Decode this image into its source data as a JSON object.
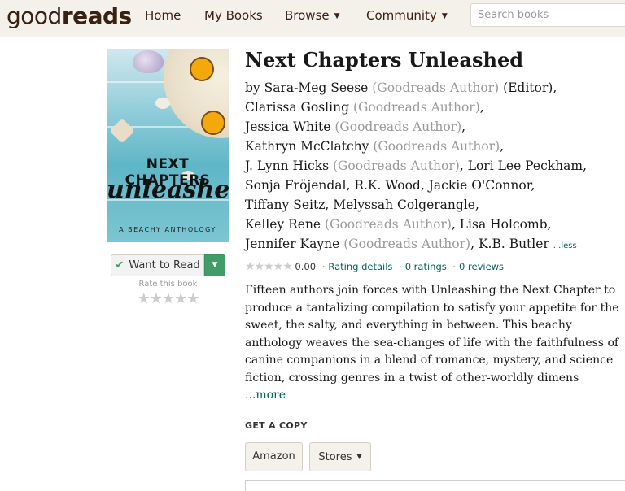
{
  "header": {
    "logo_light": "good",
    "logo_bold": "reads",
    "nav": [
      {
        "label": "Home"
      },
      {
        "label": "My Books"
      },
      {
        "label": "Browse"
      },
      {
        "label": "Community"
      }
    ],
    "search_placeholder": "Search books"
  },
  "book": {
    "title": "Next Chapters Unleashed",
    "cover": {
      "title_line1": "NEXT CHAPTERS",
      "title_line2": "unleashed",
      "subtitle": "A BEACHY ANTHOLOGY"
    },
    "authors": {
      "by": "by",
      "sara": "Sara-Meg Seese",
      "gr_author": "(Goodreads Author)",
      "editor": "(Editor),",
      "clarissa": "Clarissa Gosling",
      "jessica": "Jessica White",
      "kathryn": "Kathryn McClatchy",
      "lynn": "J. Lynn Hicks",
      "lori": "Lori Lee Peckham,",
      "sonja": "Sonja Fröjendal, R.K. Wood, Jackie O'Connor,",
      "tiffany": "Tiffany Seitz, Melyssah Colgerangle,",
      "kelley": "Kelley Rene",
      "lisa": "Lisa Holcomb,",
      "jennifer": "Jennifer Kayne",
      "kb": "K.B. Butler",
      "less": "...less",
      "comma": ","
    },
    "rating": {
      "stars": "★★★★★",
      "value": "0.00",
      "rating_details": "Rating details",
      "ratings": "0 ratings",
      "reviews": "0 reviews"
    },
    "description": "Fifteen authors join forces with Unleashing the Next Chapter to produce a tantalizing compilation to satisfy your appetite for the sweet, the salty, and everything in between. This beachy anthology weaves the sea-changes of life with the faithfulness of canine companions in a blend of romance, mystery, and science fiction, crossing genres in a twist of other-worldly dimens",
    "more": "...more"
  },
  "shelf": {
    "want_to_read": "Want to Read",
    "rate_label": "Rate this book",
    "rate_stars": [
      "★",
      "★",
      "★",
      "★",
      "★"
    ]
  },
  "get_copy": {
    "heading": "GET A COPY",
    "amazon": "Amazon",
    "stores": "Stores"
  },
  "colors": {
    "header_bg": "#f4f1ea",
    "link": "#00635d",
    "wtr_green": "#409d69",
    "gray_text": "#999999"
  }
}
